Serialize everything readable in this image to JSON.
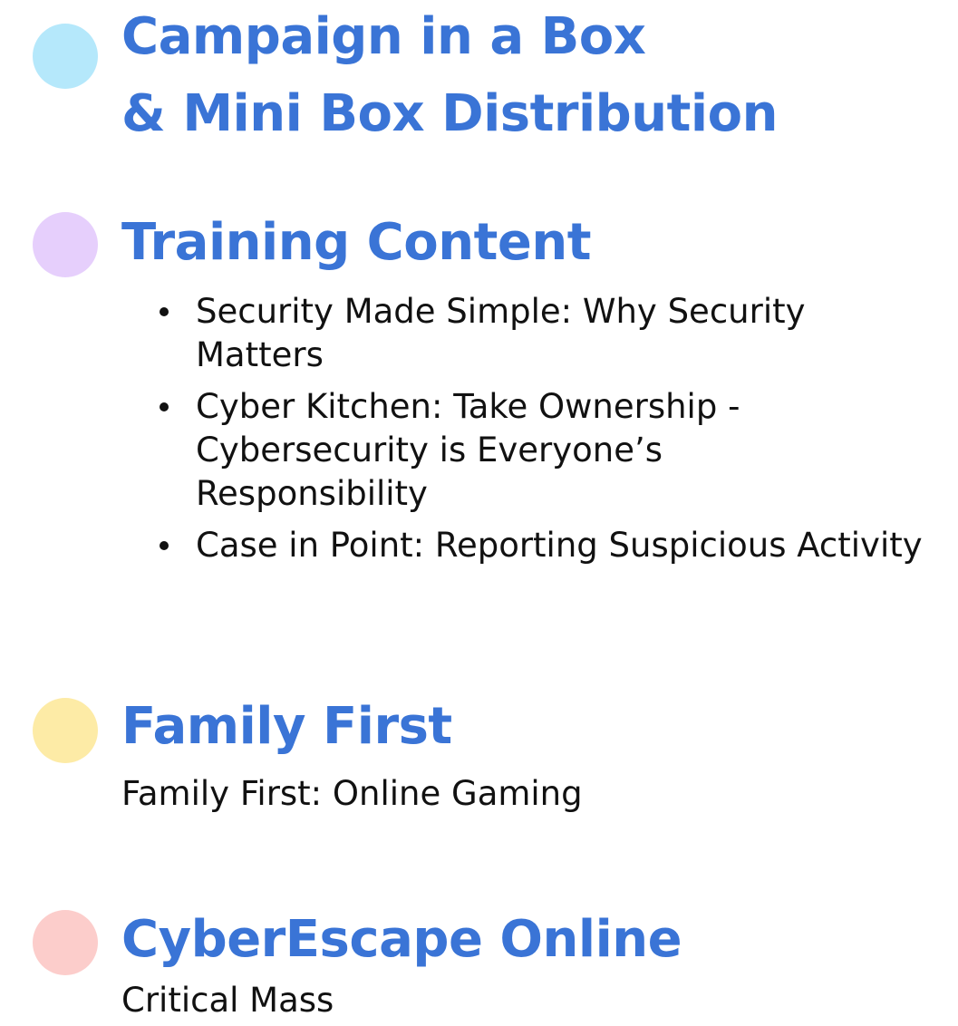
{
  "colors": {
    "heading": "#3A74D6",
    "text": "#111111",
    "dot_campaign": "#B5E8FB",
    "dot_training": "#E6CFFC",
    "dot_family": "#FDEBA6",
    "dot_cyberescape": "#FCCDCB"
  },
  "sections": {
    "campaign": {
      "icon": "circle-dot",
      "title_line1": "Campaign in a Box",
      "title_line2": "& Mini Box Distribution"
    },
    "training": {
      "icon": "circle-dot",
      "title": "Training Content",
      "items": [
        "Security Made Simple: Why Security Matters",
        "Cyber Kitchen: Take Ownership - Cybersecurity is Everyone’s Responsibility",
        "Case in Point: Reporting Suspicious Activity"
      ]
    },
    "family": {
      "icon": "circle-dot",
      "title": "Family First",
      "subtitle": "Family First: Online Gaming"
    },
    "cyberescape": {
      "icon": "circle-dot",
      "title": "CyberEscape Online",
      "subtitle": "Critical Mass"
    }
  }
}
